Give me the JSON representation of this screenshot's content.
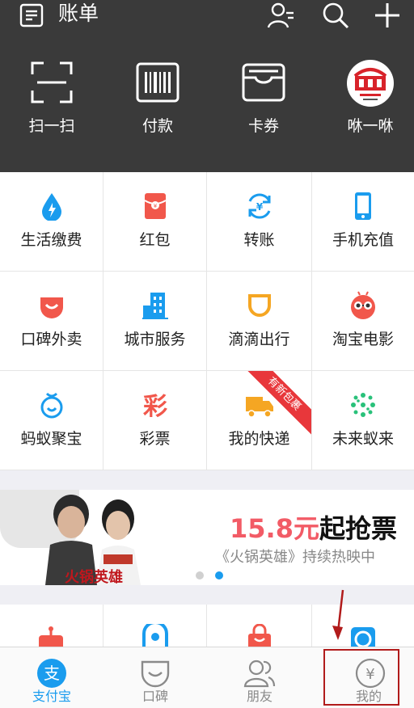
{
  "header": {
    "title": "账单",
    "quick_actions": [
      {
        "label": "扫一扫",
        "icon": "scan-icon"
      },
      {
        "label": "付款",
        "icon": "barcode-icon"
      },
      {
        "label": "卡券",
        "icon": "wallet-icon"
      },
      {
        "label": "咻一咻",
        "icon": "chinese-dream-badge-icon"
      }
    ]
  },
  "grid": [
    {
      "label": "生活缴费",
      "icon": "water-drop-bolt-icon",
      "color": "#1a9cee"
    },
    {
      "label": "红包",
      "icon": "red-envelope-icon",
      "color": "#f1574b"
    },
    {
      "label": "转账",
      "icon": "transfer-icon",
      "color": "#1a9cee"
    },
    {
      "label": "手机充值",
      "icon": "mobile-phone-icon",
      "color": "#1a9cee"
    },
    {
      "label": "口碑外卖",
      "icon": "koubei-smile-icon",
      "color": "#f1574b"
    },
    {
      "label": "城市服务",
      "icon": "city-building-icon",
      "color": "#1a9cee"
    },
    {
      "label": "滴滴出行",
      "icon": "didi-icon",
      "color": "#f5a623"
    },
    {
      "label": "淘宝电影",
      "icon": "movie-face-icon",
      "color": "#f1574b"
    },
    {
      "label": "蚂蚁聚宝",
      "icon": "ant-treasure-icon",
      "color": "#1a9cee"
    },
    {
      "label": "彩票",
      "icon": "lottery-icon",
      "color": "#f1574b"
    },
    {
      "label": "我的快递",
      "icon": "delivery-truck-icon",
      "color": "#f5a623",
      "ribbon": "有新包裹"
    },
    {
      "label": "未来蚁来",
      "icon": "future-dots-icon",
      "color": "#29c17a"
    }
  ],
  "banner": {
    "price": "15.8元",
    "buy": "起抢票",
    "subtitle": "《火锅英雄》持续热映中",
    "movie_title": "火锅英雄"
  },
  "tabs": [
    {
      "label": "支付宝",
      "icon": "alipay-icon",
      "active": true
    },
    {
      "label": "口碑",
      "icon": "koubei-tab-icon",
      "active": false
    },
    {
      "label": "朋友",
      "icon": "friends-icon",
      "active": false
    },
    {
      "label": "我的",
      "icon": "my-wallet-yen-icon",
      "active": false
    }
  ],
  "colors": {
    "accent": "#1a9cee",
    "header_bg": "#3a3a3a",
    "price_red": "#f25b66",
    "annotation_red": "#b11b1b"
  }
}
